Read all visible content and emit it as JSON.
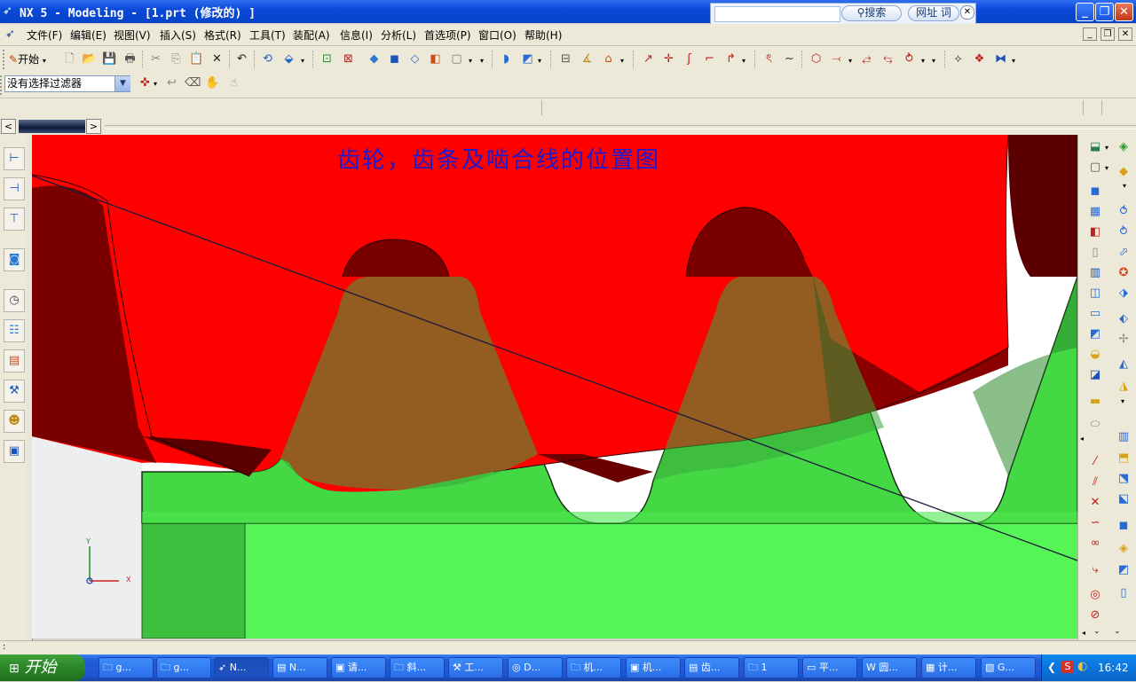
{
  "window": {
    "title": "NX 5 - Modeling - [1.prt  (修改的) ]",
    "app_icon": "nx-logo-icon",
    "controls": [
      "minimize-icon",
      "restore-icon",
      "close-icon"
    ]
  },
  "search_popup": {
    "search_label": "搜索",
    "url_label": "网址",
    "word_label": "词"
  },
  "menu": {
    "items": [
      "文件(F)",
      "编辑(E)",
      "视图(V)",
      "插入(S)",
      "格式(R)",
      "工具(T)",
      "装配(A)",
      "信息(I)",
      "分析(L)",
      "首选项(P)",
      "窗口(O)",
      "帮助(H)"
    ]
  },
  "toolbar": {
    "start_label": "开始",
    "filter_value": "没有选择过滤器"
  },
  "viewport": {
    "caption": "齿轮，齿条及啮合线的位置图",
    "axis_x": "X",
    "axis_y": "Y",
    "colors": {
      "gear_red": "#ff0000",
      "gear_dark": "#7a0000",
      "rack_green": "#55f555",
      "rack_shade": "#2e9e2e",
      "line_color": "#1a1a3a"
    }
  },
  "taskbar": {
    "start_label": "开始",
    "tasks": [
      {
        "icon": "folder-icon",
        "label": "g..."
      },
      {
        "icon": "folder-icon",
        "label": "g..."
      },
      {
        "icon": "nx-logo-icon",
        "label": "N..."
      },
      {
        "icon": "document-icon",
        "label": "N..."
      },
      {
        "icon": "pdf-icon",
        "label": "请..."
      },
      {
        "icon": "folder-icon",
        "label": "斜..."
      },
      {
        "icon": "tool-icon",
        "label": "工..."
      },
      {
        "icon": "browser-icon",
        "label": "D..."
      },
      {
        "icon": "folder-icon",
        "label": "机..."
      },
      {
        "icon": "pdf-icon",
        "label": "机..."
      },
      {
        "icon": "document-icon",
        "label": "齿..."
      },
      {
        "icon": "folder-icon",
        "label": "1"
      },
      {
        "icon": "window-icon",
        "label": "平..."
      },
      {
        "icon": "word-icon",
        "label": "圆..."
      },
      {
        "icon": "calc-icon",
        "label": "计..."
      },
      {
        "icon": "image-icon",
        "label": "G..."
      }
    ],
    "clock": "16:42"
  }
}
